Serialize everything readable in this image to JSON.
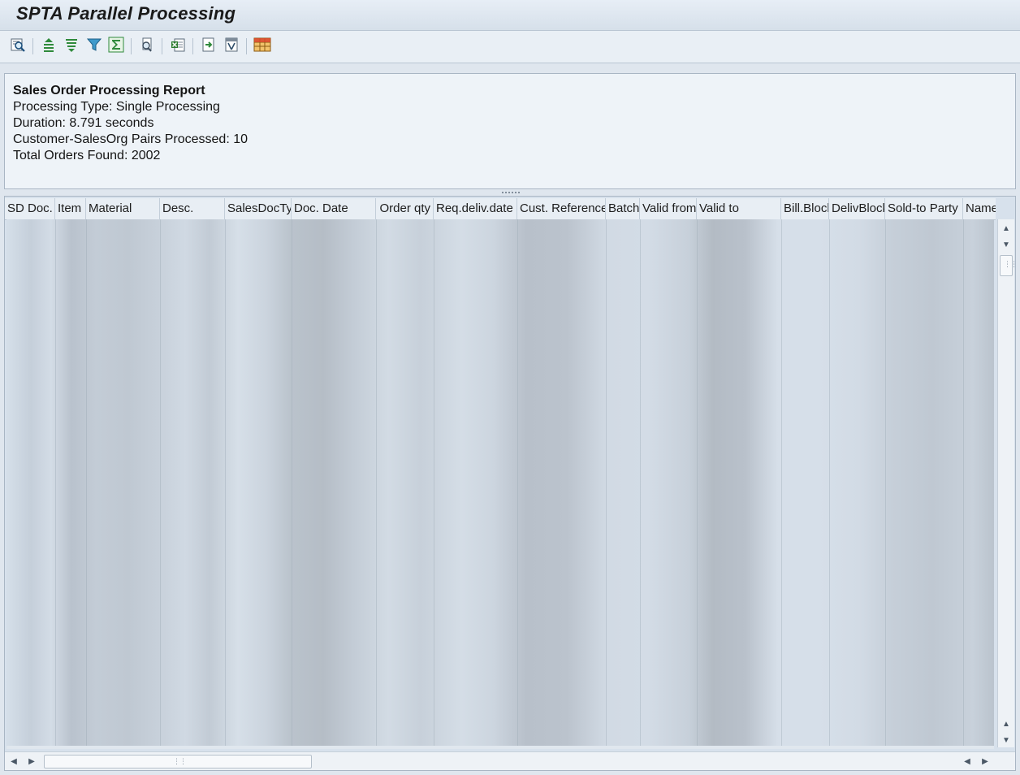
{
  "window": {
    "title": "SPTA Parallel Processing"
  },
  "toolbar": {
    "buttons": [
      {
        "icon": "details-magnifier-icon",
        "tooltip": "Details"
      },
      {
        "icon": "sort-ascending-icon",
        "tooltip": "Sort in Ascending Order"
      },
      {
        "icon": "sort-descending-icon",
        "tooltip": "Sort in Descending Order"
      },
      {
        "icon": "filter-icon",
        "tooltip": "Set Filter"
      },
      {
        "icon": "sum-icon",
        "tooltip": "Total"
      },
      {
        "icon": "print-preview-icon",
        "tooltip": "Print Preview"
      },
      {
        "icon": "excel-export-icon",
        "tooltip": "Microsoft Excel"
      },
      {
        "icon": "export-icon",
        "tooltip": "Export"
      },
      {
        "icon": "word-processing-icon",
        "tooltip": "Word Processing"
      },
      {
        "icon": "layout-grid-icon",
        "tooltip": "Change Layout"
      }
    ]
  },
  "report": {
    "title": "Sales Order Processing Report",
    "processing_type": "Processing Type: Single Processing",
    "duration": "Duration: 8.791 seconds",
    "pairs_processed": "Customer-SalesOrg Pairs Processed: 10",
    "total_orders": "Total Orders Found: 2002"
  },
  "grid": {
    "columns": [
      "SD Doc.",
      "Item",
      "Material",
      "Desc.",
      "SalesDocTy",
      "Doc. Date",
      "Order qty",
      "Req.deliv.date",
      "Cust. Reference",
      "Batch",
      "Valid from",
      "Valid to",
      "Bill.Block",
      "DelivBlock",
      "Sold-to Party",
      "Name"
    ],
    "rows_blurred": true
  },
  "colors": {
    "titlebar": "#dce5ee",
    "panel": "#eef3f8",
    "grid_body": "#d7e1ec",
    "border": "#a9b6c4"
  }
}
